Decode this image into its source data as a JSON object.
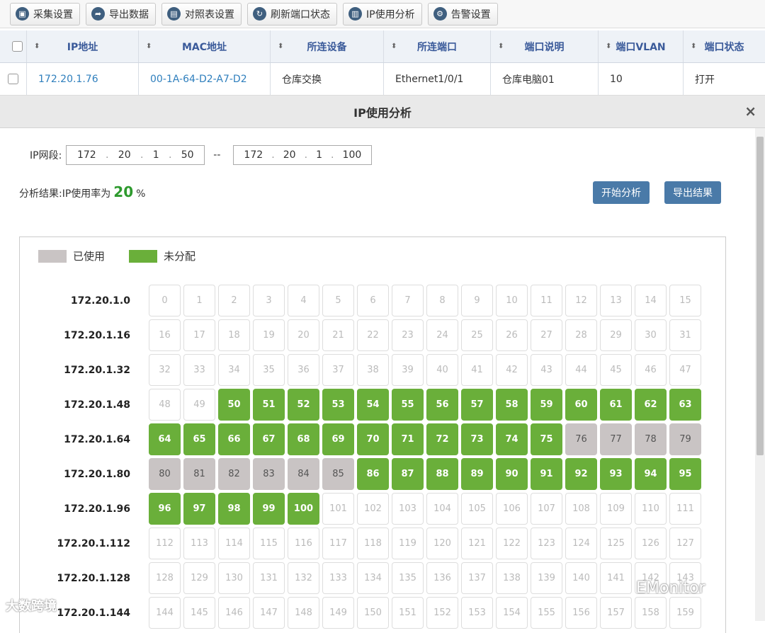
{
  "toolbar": [
    {
      "icon": "▣",
      "label": "采集设置",
      "name": "collect-settings-button"
    },
    {
      "icon": "➦",
      "label": "导出数据",
      "name": "export-data-button"
    },
    {
      "icon": "▤",
      "label": "对照表设置",
      "name": "mapping-table-button"
    },
    {
      "icon": "↻",
      "label": "刷新端口状态",
      "name": "refresh-port-button"
    },
    {
      "icon": "▥",
      "label": "IP使用分析",
      "name": "ip-analysis-button"
    },
    {
      "icon": "⚙",
      "label": "告警设置",
      "name": "alarm-settings-button"
    }
  ],
  "table": {
    "sort_icon": "⬍",
    "headers": [
      "IP地址",
      "MAC地址",
      "所连设备",
      "所连端口",
      "端口说明",
      "端口VLAN",
      "端口状态"
    ],
    "row": {
      "ip": "172.20.1.76",
      "mac": "00-1A-64-D2-A7-D2",
      "device": "仓库交换",
      "port": "Ethernet1/0/1",
      "desc": "仓库电脑01",
      "vlan": "10",
      "status": "打开"
    }
  },
  "dialog": {
    "title": "IP使用分析",
    "close": "×",
    "ip_label": "IP网段:",
    "range_sep": "--",
    "start_ip": [
      "172",
      "20",
      "1",
      "50"
    ],
    "end_ip": [
      "172",
      "20",
      "1",
      "100"
    ],
    "result_label": "分析结果:",
    "result_text": "IP使用率为",
    "usage_percent": "20",
    "percent_sign": "%",
    "start_button": "开始分析",
    "export_button": "导出结果",
    "legend_used": "已使用",
    "legend_free": "未分配",
    "color_used": "#c9c4c4",
    "color_free": "#6aaf3a",
    "row_labels": [
      "172.20.1.0",
      "172.20.1.16",
      "172.20.1.32",
      "172.20.1.48",
      "172.20.1.64",
      "172.20.1.80",
      "172.20.1.96",
      "172.20.1.112",
      "172.20.1.128",
      "172.20.1.144"
    ],
    "used_addresses": [
      76,
      77,
      78,
      79,
      80,
      81,
      82,
      83,
      84,
      85
    ],
    "range_start": 50,
    "range_end": 100
  },
  "watermarks": {
    "left": "大数跨境",
    "right": "EMonitor"
  }
}
